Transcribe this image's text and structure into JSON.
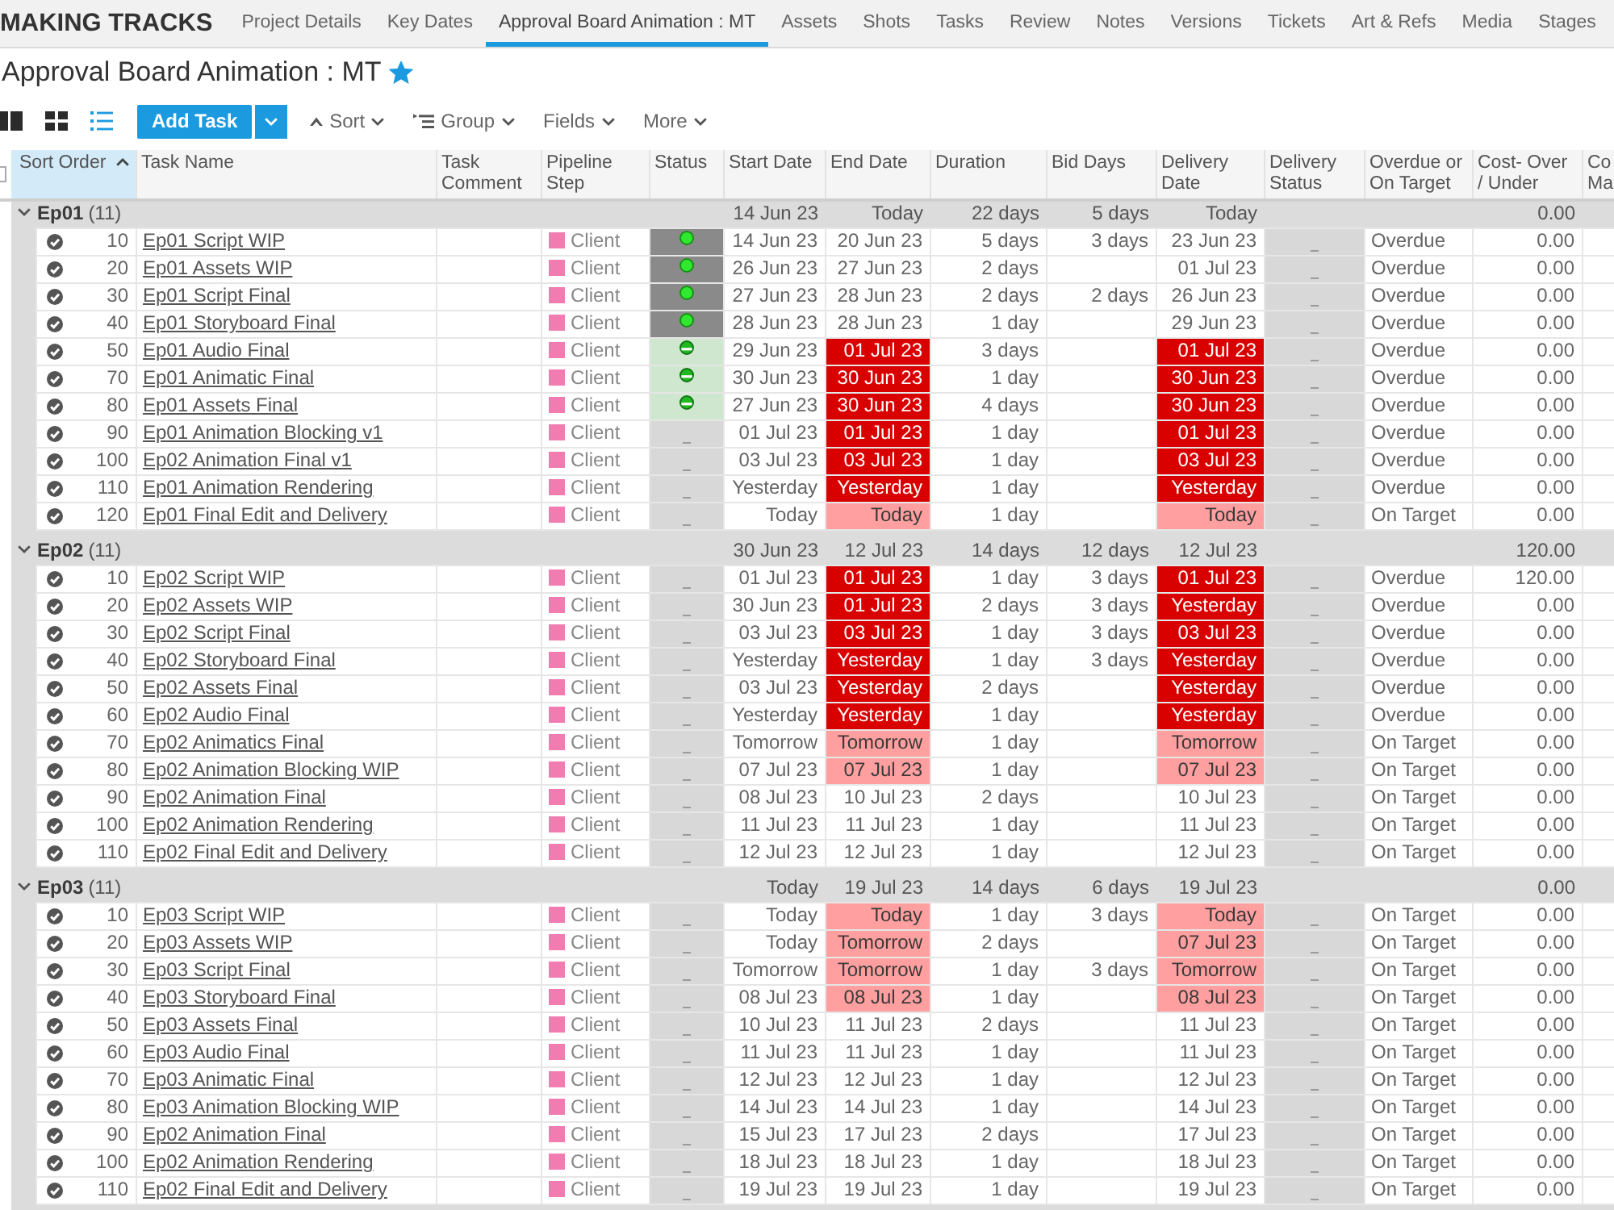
{
  "nav": {
    "logo": "MAKING TRACKS",
    "tabs": [
      {
        "label": "Project Details",
        "selected": false
      },
      {
        "label": "Key Dates",
        "selected": false
      },
      {
        "label": "Approval Board Animation : MT",
        "selected": true
      },
      {
        "label": "Assets",
        "selected": false
      },
      {
        "label": "Shots",
        "selected": false
      },
      {
        "label": "Tasks",
        "selected": false
      },
      {
        "label": "Review",
        "selected": false
      },
      {
        "label": "Notes",
        "selected": false
      },
      {
        "label": "Versions",
        "selected": false
      },
      {
        "label": "Tickets",
        "selected": false
      },
      {
        "label": "Art & Refs",
        "selected": false
      },
      {
        "label": "Media",
        "selected": false
      },
      {
        "label": "Stages",
        "selected": false
      }
    ]
  },
  "page": {
    "title": "Approval Board Animation : MT",
    "favorite": true
  },
  "toolbar": {
    "views": [
      {
        "kind": "columns",
        "selected": false
      },
      {
        "kind": "grid",
        "selected": false
      },
      {
        "kind": "list",
        "selected": true
      }
    ],
    "add_button": "Add Task",
    "menus": [
      {
        "kind": "sort",
        "label": "Sort"
      },
      {
        "kind": "group",
        "label": "Group"
      },
      {
        "kind": "plain",
        "label": "Fields"
      },
      {
        "kind": "plain",
        "label": "More"
      }
    ]
  },
  "table": {
    "select_all": {
      "checked": false
    },
    "columns": [
      {
        "label": "Sort Order",
        "sorted": true
      },
      {
        "label": "Task Name",
        "sorted": false
      },
      {
        "label": "Task Comment",
        "sorted": false
      },
      {
        "label": "Pipeline Step",
        "sorted": false
      },
      {
        "label": "Status",
        "sorted": false
      },
      {
        "label": "Start Date",
        "sorted": false
      },
      {
        "label": "End Date",
        "sorted": false
      },
      {
        "label": "Duration",
        "sorted": false
      },
      {
        "label": "Bid Days",
        "sorted": false
      },
      {
        "label": "Delivery Date",
        "sorted": false
      },
      {
        "label": "Delivery Status",
        "sorted": false
      },
      {
        "label": "Overdue or On Target",
        "sorted": false
      },
      {
        "label": "Cost- Over / Under",
        "sorted": false
      },
      {
        "label": "Co Ma",
        "sorted": false
      }
    ],
    "groups": [
      {
        "name": "Ep01",
        "count": "(11)",
        "expanded": true,
        "totals": {
          "start": "14 Jun 23",
          "end": "Today",
          "duration": "22 days",
          "bid_days": "5 days",
          "delivery": "Today",
          "cost": "0.00"
        },
        "rows": [
          {
            "order": "10",
            "task": "Ep01 Script WIP",
            "step": {
              "label": "Client",
              "color": "#f07cb0"
            },
            "status": {
              "kind": "complete"
            },
            "start": "14 Jun 23",
            "end": {
              "text": "20 Jun 23",
              "overdue": false,
              "due_soon": false
            },
            "duration": "5 days",
            "bid_days": "3 days",
            "delivery": {
              "text": "23 Jun 23",
              "overdue": false,
              "due_soon": false
            },
            "delivery_status": {
              "kind": "waiting"
            },
            "target": "Overdue",
            "cost": "0.00"
          },
          {
            "order": "20",
            "task": "Ep01 Assets WIP",
            "step": {
              "label": "Client",
              "color": "#f07cb0"
            },
            "status": {
              "kind": "complete"
            },
            "start": "26 Jun 23",
            "end": {
              "text": "27 Jun 23",
              "overdue": false,
              "due_soon": false
            },
            "duration": "2 days",
            "delivery": {
              "text": "01 Jul 23",
              "overdue": false,
              "due_soon": false
            },
            "delivery_status": {
              "kind": "waiting"
            },
            "target": "Overdue",
            "cost": "0.00"
          },
          {
            "order": "30",
            "task": "Ep01 Script Final",
            "step": {
              "label": "Client",
              "color": "#f07cb0"
            },
            "status": {
              "kind": "complete"
            },
            "start": "27 Jun 23",
            "end": {
              "text": "28 Jun 23",
              "overdue": false,
              "due_soon": false
            },
            "duration": "2 days",
            "bid_days": "2 days",
            "delivery": {
              "text": "26 Jun 23",
              "overdue": false,
              "due_soon": false
            },
            "delivery_status": {
              "kind": "waiting"
            },
            "target": "Overdue",
            "cost": "0.00"
          },
          {
            "order": "40",
            "task": "Ep01 Storyboard Final",
            "step": {
              "label": "Client",
              "color": "#f07cb0"
            },
            "status": {
              "kind": "complete"
            },
            "start": "28 Jun 23",
            "end": {
              "text": "28 Jun 23",
              "overdue": false,
              "due_soon": false
            },
            "duration": "1 day",
            "delivery": {
              "text": "29 Jun 23",
              "overdue": false,
              "due_soon": false
            },
            "delivery_status": {
              "kind": "waiting"
            },
            "target": "Overdue",
            "cost": "0.00"
          },
          {
            "order": "50",
            "task": "Ep01 Audio Final",
            "step": {
              "label": "Client",
              "color": "#f07cb0"
            },
            "status": {
              "kind": "in_progress"
            },
            "start": "29 Jun 23",
            "end": {
              "text": "01 Jul 23",
              "overdue": true,
              "due_soon": false
            },
            "duration": "3 days",
            "delivery": {
              "text": "01 Jul 23",
              "overdue": true,
              "due_soon": false
            },
            "delivery_status": {
              "kind": "waiting"
            },
            "target": "Overdue",
            "cost": "0.00"
          },
          {
            "order": "70",
            "task": "Ep01 Animatic Final",
            "step": {
              "label": "Client",
              "color": "#f07cb0"
            },
            "status": {
              "kind": "in_progress"
            },
            "start": "30 Jun 23",
            "end": {
              "text": "30 Jun 23",
              "overdue": true,
              "due_soon": false
            },
            "duration": "1 day",
            "delivery": {
              "text": "30 Jun 23",
              "overdue": true,
              "due_soon": false
            },
            "delivery_status": {
              "kind": "waiting"
            },
            "target": "Overdue",
            "cost": "0.00"
          },
          {
            "order": "80",
            "task": "Ep01 Assets Final",
            "step": {
              "label": "Client",
              "color": "#f07cb0"
            },
            "status": {
              "kind": "in_progress"
            },
            "start": "27 Jun 23",
            "end": {
              "text": "30 Jun 23",
              "overdue": true,
              "due_soon": false
            },
            "duration": "4 days",
            "delivery": {
              "text": "30 Jun 23",
              "overdue": true,
              "due_soon": false
            },
            "delivery_status": {
              "kind": "waiting"
            },
            "target": "Overdue",
            "cost": "0.00"
          },
          {
            "order": "90",
            "task": "Ep01 Animation Blocking v1",
            "step": {
              "label": "Client",
              "color": "#f07cb0"
            },
            "status": {
              "kind": "waiting"
            },
            "start": "01 Jul 23",
            "end": {
              "text": "01 Jul 23",
              "overdue": true,
              "due_soon": false
            },
            "duration": "1 day",
            "delivery": {
              "text": "01 Jul 23",
              "overdue": true,
              "due_soon": false
            },
            "delivery_status": {
              "kind": "waiting"
            },
            "target": "Overdue",
            "cost": "0.00"
          },
          {
            "order": "100",
            "task": "Ep02 Animation Final v1",
            "step": {
              "label": "Client",
              "color": "#f07cb0"
            },
            "status": {
              "kind": "waiting"
            },
            "start": "03 Jul 23",
            "end": {
              "text": "03 Jul 23",
              "overdue": true,
              "due_soon": false
            },
            "duration": "1 day",
            "delivery": {
              "text": "03 Jul 23",
              "overdue": true,
              "due_soon": false
            },
            "delivery_status": {
              "kind": "waiting"
            },
            "target": "Overdue",
            "cost": "0.00"
          },
          {
            "order": "110",
            "task": "Ep01 Animation Rendering",
            "step": {
              "label": "Client",
              "color": "#f07cb0"
            },
            "status": {
              "kind": "waiting"
            },
            "start": "Yesterday",
            "end": {
              "text": "Yesterday",
              "overdue": true,
              "due_soon": false
            },
            "duration": "1 day",
            "delivery": {
              "text": "Yesterday",
              "overdue": true,
              "due_soon": false
            },
            "delivery_status": {
              "kind": "waiting"
            },
            "target": "Overdue",
            "cost": "0.00"
          },
          {
            "order": "120",
            "task": "Ep01 Final Edit and Delivery",
            "step": {
              "label": "Client",
              "color": "#f07cb0"
            },
            "status": {
              "kind": "waiting"
            },
            "start": "Today",
            "end": {
              "text": "Today",
              "overdue": false,
              "due_soon": true
            },
            "duration": "1 day",
            "delivery": {
              "text": "Today",
              "overdue": false,
              "due_soon": true
            },
            "delivery_status": {
              "kind": "waiting"
            },
            "target": "On Target",
            "cost": "0.00"
          }
        ]
      },
      {
        "name": "Ep02",
        "count": "(11)",
        "expanded": true,
        "totals": {
          "start": "30 Jun 23",
          "end": "12 Jul 23",
          "duration": "14 days",
          "bid_days": "12 days",
          "delivery": "12 Jul 23",
          "cost": "120.00"
        },
        "rows": [
          {
            "order": "10",
            "task": "Ep02 Script WIP",
            "step": {
              "label": "Client",
              "color": "#f07cb0"
            },
            "status": {
              "kind": "waiting"
            },
            "start": "01 Jul 23",
            "end": {
              "text": "01 Jul 23",
              "overdue": true,
              "due_soon": false
            },
            "duration": "1 day",
            "bid_days": "3 days",
            "delivery": {
              "text": "01 Jul 23",
              "overdue": true,
              "due_soon": false
            },
            "delivery_status": {
              "kind": "waiting"
            },
            "target": "Overdue",
            "cost": "120.00"
          },
          {
            "order": "20",
            "task": "Ep02 Assets WIP",
            "step": {
              "label": "Client",
              "color": "#f07cb0"
            },
            "status": {
              "kind": "waiting"
            },
            "start": "30 Jun 23",
            "end": {
              "text": "01 Jul 23",
              "overdue": true,
              "due_soon": false
            },
            "duration": "2 days",
            "bid_days": "3 days",
            "delivery": {
              "text": "Yesterday",
              "overdue": true,
              "due_soon": false
            },
            "delivery_status": {
              "kind": "waiting"
            },
            "target": "Overdue",
            "cost": "0.00"
          },
          {
            "order": "30",
            "task": "Ep02 Script Final",
            "step": {
              "label": "Client",
              "color": "#f07cb0"
            },
            "status": {
              "kind": "waiting"
            },
            "start": "03 Jul 23",
            "end": {
              "text": "03 Jul 23",
              "overdue": true,
              "due_soon": false
            },
            "duration": "1 day",
            "bid_days": "3 days",
            "delivery": {
              "text": "03 Jul 23",
              "overdue": true,
              "due_soon": false
            },
            "delivery_status": {
              "kind": "waiting"
            },
            "target": "Overdue",
            "cost": "0.00"
          },
          {
            "order": "40",
            "task": "Ep02 Storyboard Final",
            "step": {
              "label": "Client",
              "color": "#f07cb0"
            },
            "status": {
              "kind": "waiting"
            },
            "start": "Yesterday",
            "end": {
              "text": "Yesterday",
              "overdue": true,
              "due_soon": false
            },
            "duration": "1 day",
            "bid_days": "3 days",
            "delivery": {
              "text": "Yesterday",
              "overdue": true,
              "due_soon": false
            },
            "delivery_status": {
              "kind": "waiting"
            },
            "target": "Overdue",
            "cost": "0.00"
          },
          {
            "order": "50",
            "task": "Ep02 Assets Final",
            "step": {
              "label": "Client",
              "color": "#f07cb0"
            },
            "status": {
              "kind": "waiting"
            },
            "start": "03 Jul 23",
            "end": {
              "text": "Yesterday",
              "overdue": true,
              "due_soon": false
            },
            "duration": "2 days",
            "delivery": {
              "text": "Yesterday",
              "overdue": true,
              "due_soon": false
            },
            "delivery_status": {
              "kind": "waiting"
            },
            "target": "Overdue",
            "cost": "0.00"
          },
          {
            "order": "60",
            "task": "Ep02 Audio Final",
            "step": {
              "label": "Client",
              "color": "#f07cb0"
            },
            "status": {
              "kind": "waiting"
            },
            "start": "Yesterday",
            "end": {
              "text": "Yesterday",
              "overdue": true,
              "due_soon": false
            },
            "duration": "1 day",
            "delivery": {
              "text": "Yesterday",
              "overdue": true,
              "due_soon": false
            },
            "delivery_status": {
              "kind": "waiting"
            },
            "target": "Overdue",
            "cost": "0.00"
          },
          {
            "order": "70",
            "task": "Ep02 Animatics Final",
            "step": {
              "label": "Client",
              "color": "#f07cb0"
            },
            "status": {
              "kind": "waiting"
            },
            "start": "Tomorrow",
            "end": {
              "text": "Tomorrow",
              "overdue": false,
              "due_soon": true
            },
            "duration": "1 day",
            "delivery": {
              "text": "Tomorrow",
              "overdue": false,
              "due_soon": true
            },
            "delivery_status": {
              "kind": "waiting"
            },
            "target": "On Target",
            "cost": "0.00"
          },
          {
            "order": "80",
            "task": "Ep02 Animation Blocking WIP",
            "step": {
              "label": "Client",
              "color": "#f07cb0"
            },
            "status": {
              "kind": "waiting"
            },
            "start": "07 Jul 23",
            "end": {
              "text": "07 Jul 23",
              "overdue": false,
              "due_soon": true
            },
            "duration": "1 day",
            "delivery": {
              "text": "07 Jul 23",
              "overdue": false,
              "due_soon": true
            },
            "delivery_status": {
              "kind": "waiting"
            },
            "target": "On Target",
            "cost": "0.00"
          },
          {
            "order": "90",
            "task": "Ep02 Animation Final",
            "step": {
              "label": "Client",
              "color": "#f07cb0"
            },
            "status": {
              "kind": "waiting"
            },
            "start": "08 Jul 23",
            "end": {
              "text": "10 Jul 23",
              "overdue": false,
              "due_soon": false
            },
            "duration": "2 days",
            "delivery": {
              "text": "10 Jul 23",
              "overdue": false,
              "due_soon": false
            },
            "delivery_status": {
              "kind": "waiting"
            },
            "target": "On Target",
            "cost": "0.00"
          },
          {
            "order": "100",
            "task": "Ep02 Animation Rendering",
            "step": {
              "label": "Client",
              "color": "#f07cb0"
            },
            "status": {
              "kind": "waiting"
            },
            "start": "11 Jul 23",
            "end": {
              "text": "11 Jul 23",
              "overdue": false,
              "due_soon": false
            },
            "duration": "1 day",
            "delivery": {
              "text": "11 Jul 23",
              "overdue": false,
              "due_soon": false
            },
            "delivery_status": {
              "kind": "waiting"
            },
            "target": "On Target",
            "cost": "0.00"
          },
          {
            "order": "110",
            "task": "Ep02 Final Edit and Delivery",
            "step": {
              "label": "Client",
              "color": "#f07cb0"
            },
            "status": {
              "kind": "waiting"
            },
            "start": "12 Jul 23",
            "end": {
              "text": "12 Jul 23",
              "overdue": false,
              "due_soon": false
            },
            "duration": "1 day",
            "delivery": {
              "text": "12 Jul 23",
              "overdue": false,
              "due_soon": false
            },
            "delivery_status": {
              "kind": "waiting"
            },
            "target": "On Target",
            "cost": "0.00"
          }
        ]
      },
      {
        "name": "Ep03",
        "count": "(11)",
        "expanded": true,
        "totals": {
          "start": "Today",
          "end": "19 Jul 23",
          "duration": "14 days",
          "bid_days": "6 days",
          "delivery": "19 Jul 23",
          "cost": "0.00"
        },
        "rows": [
          {
            "order": "10",
            "task": "Ep03 Script WIP",
            "step": {
              "label": "Client",
              "color": "#f07cb0"
            },
            "status": {
              "kind": "waiting"
            },
            "start": "Today",
            "end": {
              "text": "Today",
              "overdue": false,
              "due_soon": true
            },
            "duration": "1 day",
            "bid_days": "3 days",
            "delivery": {
              "text": "Today",
              "overdue": false,
              "due_soon": true
            },
            "delivery_status": {
              "kind": "waiting"
            },
            "target": "On Target",
            "cost": "0.00"
          },
          {
            "order": "20",
            "task": "Ep03 Assets WIP",
            "step": {
              "label": "Client",
              "color": "#f07cb0"
            },
            "status": {
              "kind": "waiting"
            },
            "start": "Today",
            "end": {
              "text": "Tomorrow",
              "overdue": false,
              "due_soon": true
            },
            "duration": "2 days",
            "delivery": {
              "text": "07 Jul 23",
              "overdue": false,
              "due_soon": true
            },
            "delivery_status": {
              "kind": "waiting"
            },
            "target": "On Target",
            "cost": "0.00"
          },
          {
            "order": "30",
            "task": "Ep03 Script Final",
            "step": {
              "label": "Client",
              "color": "#f07cb0"
            },
            "status": {
              "kind": "waiting"
            },
            "start": "Tomorrow",
            "end": {
              "text": "Tomorrow",
              "overdue": false,
              "due_soon": true
            },
            "duration": "1 day",
            "bid_days": "3 days",
            "delivery": {
              "text": "Tomorrow",
              "overdue": false,
              "due_soon": true
            },
            "delivery_status": {
              "kind": "waiting"
            },
            "target": "On Target",
            "cost": "0.00"
          },
          {
            "order": "40",
            "task": "Ep03 Storyboard Final",
            "step": {
              "label": "Client",
              "color": "#f07cb0"
            },
            "status": {
              "kind": "waiting"
            },
            "start": "08 Jul 23",
            "end": {
              "text": "08 Jul 23",
              "overdue": false,
              "due_soon": true
            },
            "duration": "1 day",
            "delivery": {
              "text": "08 Jul 23",
              "overdue": false,
              "due_soon": true
            },
            "delivery_status": {
              "kind": "waiting"
            },
            "target": "On Target",
            "cost": "0.00"
          },
          {
            "order": "50",
            "task": "Ep03 Assets Final",
            "step": {
              "label": "Client",
              "color": "#f07cb0"
            },
            "status": {
              "kind": "waiting"
            },
            "start": "10 Jul 23",
            "end": {
              "text": "11 Jul 23",
              "overdue": false,
              "due_soon": false
            },
            "duration": "2 days",
            "delivery": {
              "text": "11 Jul 23",
              "overdue": false,
              "due_soon": false
            },
            "delivery_status": {
              "kind": "waiting"
            },
            "target": "On Target",
            "cost": "0.00"
          },
          {
            "order": "60",
            "task": "Ep03 Audio Final",
            "step": {
              "label": "Client",
              "color": "#f07cb0"
            },
            "status": {
              "kind": "waiting"
            },
            "start": "11 Jul 23",
            "end": {
              "text": "11 Jul 23",
              "overdue": false,
              "due_soon": false
            },
            "duration": "1 day",
            "delivery": {
              "text": "11 Jul 23",
              "overdue": false,
              "due_soon": false
            },
            "delivery_status": {
              "kind": "waiting"
            },
            "target": "On Target",
            "cost": "0.00"
          },
          {
            "order": "70",
            "task": "Ep03 Animatic Final",
            "step": {
              "label": "Client",
              "color": "#f07cb0"
            },
            "status": {
              "kind": "waiting"
            },
            "start": "12 Jul 23",
            "end": {
              "text": "12 Jul 23",
              "overdue": false,
              "due_soon": false
            },
            "duration": "1 day",
            "delivery": {
              "text": "12 Jul 23",
              "overdue": false,
              "due_soon": false
            },
            "delivery_status": {
              "kind": "waiting"
            },
            "target": "On Target",
            "cost": "0.00"
          },
          {
            "order": "80",
            "task": "Ep03 Animation Blocking WIP",
            "step": {
              "label": "Client",
              "color": "#f07cb0"
            },
            "status": {
              "kind": "waiting"
            },
            "start": "14 Jul 23",
            "end": {
              "text": "14 Jul 23",
              "overdue": false,
              "due_soon": false
            },
            "duration": "1 day",
            "delivery": {
              "text": "14 Jul 23",
              "overdue": false,
              "due_soon": false
            },
            "delivery_status": {
              "kind": "waiting"
            },
            "target": "On Target",
            "cost": "0.00"
          },
          {
            "order": "90",
            "task": "Ep02 Animation Final",
            "step": {
              "label": "Client",
              "color": "#f07cb0"
            },
            "status": {
              "kind": "waiting"
            },
            "start": "15 Jul 23",
            "end": {
              "text": "17 Jul 23",
              "overdue": false,
              "due_soon": false
            },
            "duration": "2 days",
            "delivery": {
              "text": "17 Jul 23",
              "overdue": false,
              "due_soon": false
            },
            "delivery_status": {
              "kind": "waiting"
            },
            "target": "On Target",
            "cost": "0.00"
          },
          {
            "order": "100",
            "task": "Ep02 Animation Rendering",
            "step": {
              "label": "Client",
              "color": "#f07cb0"
            },
            "status": {
              "kind": "waiting"
            },
            "start": "18 Jul 23",
            "end": {
              "text": "18 Jul 23",
              "overdue": false,
              "due_soon": false
            },
            "duration": "1 day",
            "delivery": {
              "text": "18 Jul 23",
              "overdue": false,
              "due_soon": false
            },
            "delivery_status": {
              "kind": "waiting"
            },
            "target": "On Target",
            "cost": "0.00"
          },
          {
            "order": "110",
            "task": "Ep02 Final Edit and Delivery",
            "step": {
              "label": "Client",
              "color": "#f07cb0"
            },
            "status": {
              "kind": "waiting"
            },
            "start": "19 Jul 23",
            "end": {
              "text": "19 Jul 23",
              "overdue": false,
              "due_soon": false
            },
            "duration": "1 day",
            "delivery": {
              "text": "19 Jul 23",
              "overdue": false,
              "due_soon": false
            },
            "delivery_status": {
              "kind": "waiting"
            },
            "target": "On Target",
            "cost": "0.00"
          }
        ]
      }
    ]
  }
}
